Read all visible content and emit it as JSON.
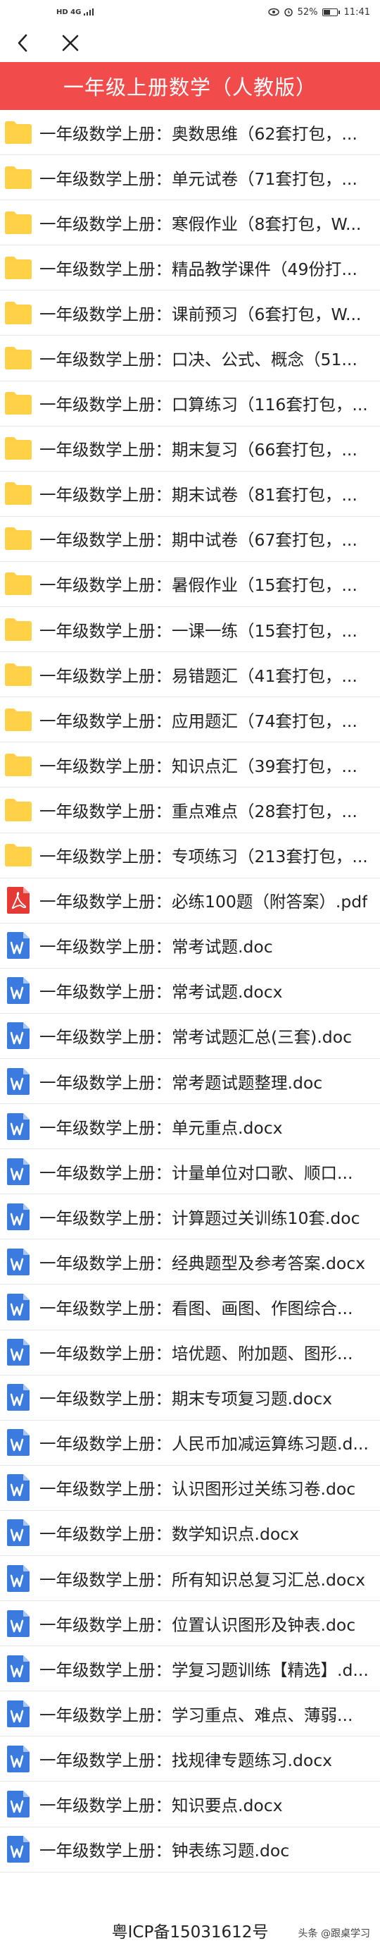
{
  "status_bar": {
    "signal": "HD 4G",
    "battery_percent": "52%",
    "battery_level": 0.52,
    "time": "11:41"
  },
  "nav": {
    "back_icon": "chevron-left-icon",
    "close_icon": "close-icon"
  },
  "header": {
    "title": "一年级上册数学（人教版）",
    "background_color": "#f24b4b"
  },
  "files": [
    {
      "type": "folder",
      "name": "一年级数学上册：奥数思维（62套打包，..."
    },
    {
      "type": "folder",
      "name": "一年级数学上册：单元试卷（71套打包，..."
    },
    {
      "type": "folder",
      "name": "一年级数学上册：寒假作业（8套打包，W..."
    },
    {
      "type": "folder",
      "name": "一年级数学上册：精品教学课件（49份打..."
    },
    {
      "type": "folder",
      "name": "一年级数学上册：课前预习（6套打包，W..."
    },
    {
      "type": "folder",
      "name": "一年级数学上册：口决、公式、概念（51..."
    },
    {
      "type": "folder",
      "name": "一年级数学上册：口算练习（116套打包，..."
    },
    {
      "type": "folder",
      "name": "一年级数学上册：期末复习（66套打包，..."
    },
    {
      "type": "folder",
      "name": "一年级数学上册：期末试卷（81套打包，..."
    },
    {
      "type": "folder",
      "name": "一年级数学上册：期中试卷（67套打包，..."
    },
    {
      "type": "folder",
      "name": "一年级数学上册：暑假作业（15套打包，..."
    },
    {
      "type": "folder",
      "name": "一年级数学上册：一课一练（15套打包，..."
    },
    {
      "type": "folder",
      "name": "一年级数学上册：易错题汇（41套打包，..."
    },
    {
      "type": "folder",
      "name": "一年级数学上册：应用题汇（74套打包，..."
    },
    {
      "type": "folder",
      "name": "一年级数学上册：知识点汇（39套打包，..."
    },
    {
      "type": "folder",
      "name": "一年级数学上册：重点难点（28套打包，..."
    },
    {
      "type": "folder",
      "name": "一年级数学上册：专项练习（213套打包，..."
    },
    {
      "type": "pdf",
      "name": "一年级数学上册：必练100题（附答案）.pdf"
    },
    {
      "type": "word",
      "name": "一年级数学上册：常考试题.doc"
    },
    {
      "type": "word",
      "name": "一年级数学上册：常考试题.docx"
    },
    {
      "type": "word",
      "name": "一年级数学上册：常考试题汇总(三套).doc"
    },
    {
      "type": "word",
      "name": "一年级数学上册：常考题试题整理.doc"
    },
    {
      "type": "word",
      "name": "一年级数学上册：单元重点.docx"
    },
    {
      "type": "word",
      "name": "一年级数学上册：计量单位对口歌、顺口..."
    },
    {
      "type": "word",
      "name": "一年级数学上册：计算题过关训练10套.doc"
    },
    {
      "type": "word",
      "name": "一年级数学上册：经典题型及参考答案.docx"
    },
    {
      "type": "word",
      "name": "一年级数学上册：看图、画图、作图综合..."
    },
    {
      "type": "word",
      "name": "一年级数学上册：培优题、附加题、图形..."
    },
    {
      "type": "word",
      "name": "一年级数学上册：期末专项复习题.docx"
    },
    {
      "type": "word",
      "name": "一年级数学上册：人民币加减运算练习题.d..."
    },
    {
      "type": "word",
      "name": "一年级数学上册：认识图形过关练习卷.doc"
    },
    {
      "type": "word",
      "name": "一年级数学上册：数学知识点.docx"
    },
    {
      "type": "word",
      "name": "一年级数学上册：所有知识总复习汇总.docx"
    },
    {
      "type": "word",
      "name": "一年级数学上册：位置认识图形及钟表.doc"
    },
    {
      "type": "word",
      "name": "一年级数学上册：学复习题训练【精选】.d..."
    },
    {
      "type": "word",
      "name": "一年级数学上册：学习重点、难点、薄弱..."
    },
    {
      "type": "word",
      "name": "一年级数学上册：找规律专题练习.docx"
    },
    {
      "type": "word",
      "name": "一年级数学上册：知识要点.docx"
    },
    {
      "type": "word",
      "name": "一年级数学上册：钟表练习题.doc"
    }
  ],
  "footer": {
    "icp": "粤ICP备15031612号",
    "watermark": "头条 @跟桌学习"
  },
  "colors": {
    "folder": "#ffd047",
    "pdf": "#e53935",
    "word": "#3b7be0"
  }
}
